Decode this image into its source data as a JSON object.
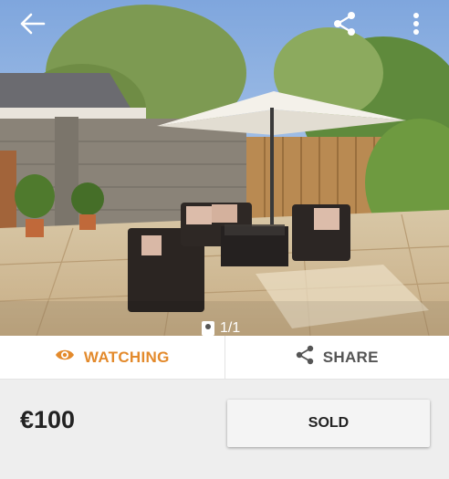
{
  "photo": {
    "counter": "1/1",
    "alt_icon": "image-icon"
  },
  "actions": {
    "watching_label": "WATCHING",
    "share_label": "SHARE"
  },
  "listing": {
    "price": "€100",
    "status_button": "SOLD"
  },
  "colors": {
    "accent": "#e38a2c",
    "background": "#eeeeee"
  }
}
